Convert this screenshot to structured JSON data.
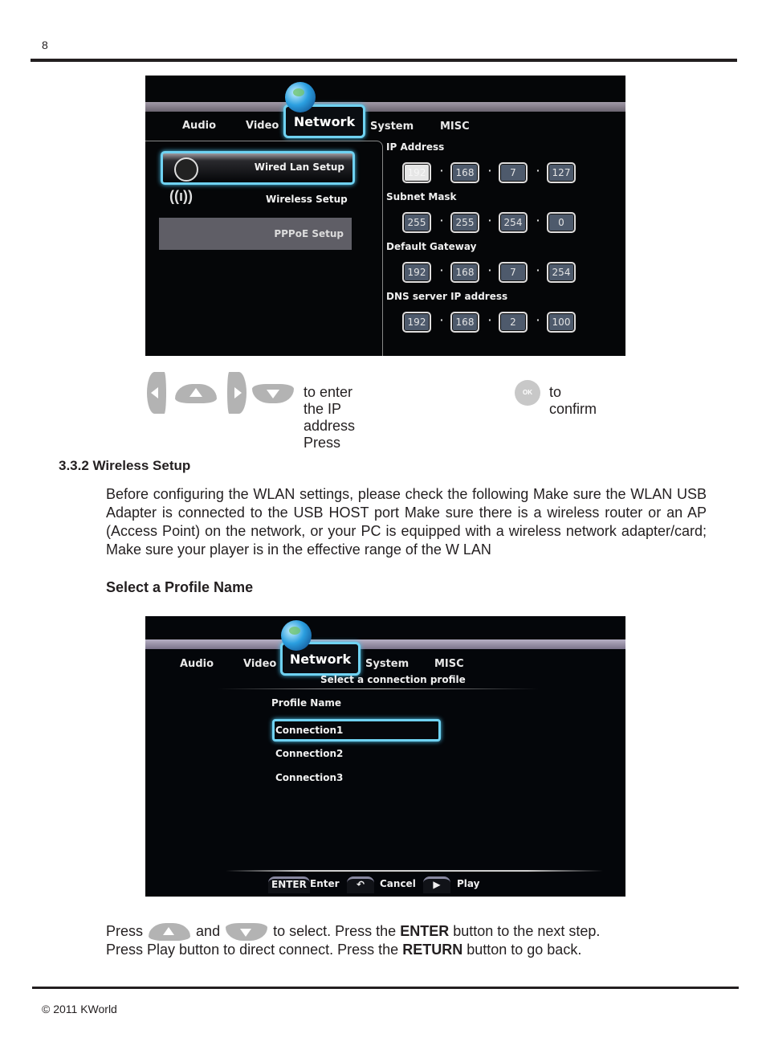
{
  "page_number": "8",
  "footer": "© 2011 KWorld",
  "screen1": {
    "tabs": [
      "Audio",
      "Video",
      "Network",
      "System",
      "MISC"
    ],
    "active_tab": "Network",
    "menu": [
      {
        "label": "Wired Lan Setup",
        "icon": "wired-lan-icon",
        "selected": true
      },
      {
        "label": "Wireless Setup",
        "icon": "wireless-icon",
        "selected": false
      },
      {
        "label": "PPPoE Setup",
        "icon": "",
        "selected": false
      }
    ],
    "fields": [
      {
        "label": "IP Address",
        "octets": [
          "192",
          "168",
          "7",
          "127"
        ]
      },
      {
        "label": "Subnet Mask",
        "octets": [
          "255",
          "255",
          "254",
          "0"
        ]
      },
      {
        "label": "Default Gateway",
        "octets": [
          "192",
          "168",
          "7",
          "254"
        ]
      },
      {
        "label": "DNS server IP address",
        "octets": [
          "192",
          "168",
          "2",
          "100"
        ]
      }
    ]
  },
  "instruction1": {
    "text_a": "to enter the IP address Press",
    "ok_label": "OK",
    "text_b": "to confirm"
  },
  "section": {
    "heading": "3.3.2 Wireless Setup",
    "paragraph": "Before configuring the WLAN settings, please check the following Make sure the WLAN USB Adapter is connected to the USB HOST port Make sure there is a wireless router or an AP (Access Point) on the network, or your PC is equipped with a wireless network adapter/card; Make sure your player is in the effective range of the W LAN",
    "subheading": "Select a Profile Name"
  },
  "screen2": {
    "tabs": [
      "Audio",
      "Video",
      "Network",
      "System",
      "MISC"
    ],
    "active_tab": "Network",
    "subtitle": "Select a connection profile",
    "profile_label": "Profile Name",
    "connections": [
      "Connection1",
      "Connection2",
      "Connection3"
    ],
    "hints": [
      {
        "key": "ENTER",
        "label": "Enter"
      },
      {
        "key": "return-icon",
        "label": "Cancel"
      },
      {
        "key": "play-icon",
        "label": "Play"
      }
    ]
  },
  "instruction2": {
    "line1_a": "Press",
    "line1_b": "and",
    "line1_c": "to select. Press the",
    "line1_bold": "ENTER",
    "line1_d": "button to the next step.",
    "line2_a": "Press Play button to direct connect. Press the",
    "line2_bold": "RETURN",
    "line2_b": "button to go back."
  }
}
